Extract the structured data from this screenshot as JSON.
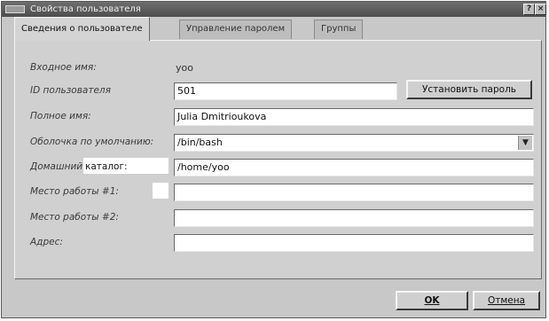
{
  "window": {
    "title": "Свойства пользователя",
    "help_btn": "?",
    "close_btn": "×"
  },
  "tabs": [
    {
      "label": "Сведения о пользователе",
      "active": true
    },
    {
      "label": "Управление паролем",
      "active": false
    },
    {
      "label": "Группы",
      "active": false
    }
  ],
  "form": {
    "login_label": "Входное имя:",
    "login_value": "yoo",
    "uid_label": "ID пользователя",
    "uid_value": "501",
    "set_password_label": "Установить пароль",
    "fullname_label": "Полное имя:",
    "fullname_value": "Julia Dmitrioukova",
    "shell_label": "Оболочка по умолчанию:",
    "shell_value": "/bin/bash",
    "home_label_a": "Домашний",
    "home_label_b": "каталог:",
    "home_value": "/home/yoo",
    "work1_label": "Место работы #1:",
    "work1_value": "",
    "work2_label": "Место работы #2:",
    "work2_value": "",
    "address_label": "Адрес:",
    "address_value": ""
  },
  "footer": {
    "ok_label": "OK",
    "cancel_label": "Отмена"
  },
  "icons": {
    "combo": "chevron-down-icon"
  }
}
